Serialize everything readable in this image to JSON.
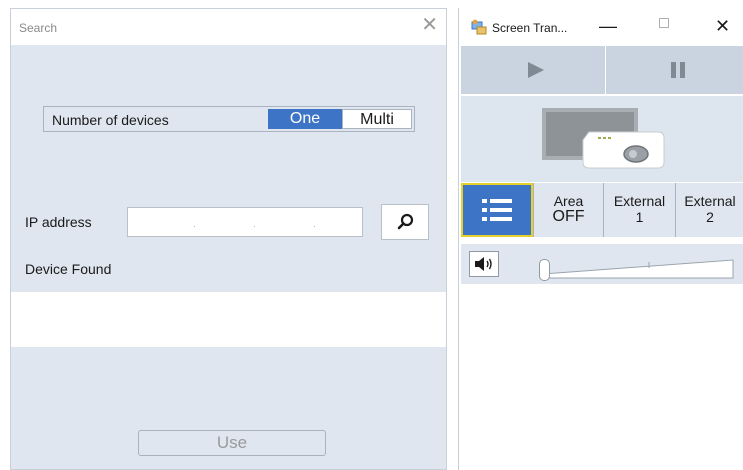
{
  "search": {
    "title": "Search",
    "number_of_devices_label": "Number of devices",
    "option_one": "One",
    "option_multi": "Multi",
    "selected": "One",
    "ip_address_label": "IP address",
    "ip_value": "",
    "device_found_label": "Device Found",
    "use_button_label": "Use"
  },
  "screen_transfer": {
    "title": "Screen Tran...",
    "modes": [
      {
        "line1": "Area",
        "line2": "OFF"
      },
      {
        "line1": "External",
        "line2": "1"
      },
      {
        "line1": "External",
        "line2": "2"
      }
    ]
  },
  "colors": {
    "accent": "#3d74c6",
    "panel": "#dfe6ef",
    "focus_outline": "#e6d02a"
  },
  "icons": {
    "search_close": "close-icon",
    "ip_search": "search-icon",
    "app": "screen-transfer-icon",
    "play": "play-icon",
    "pause": "pause-icon",
    "projector": "projector-icon",
    "list": "list-icon",
    "volume": "speaker-icon"
  }
}
